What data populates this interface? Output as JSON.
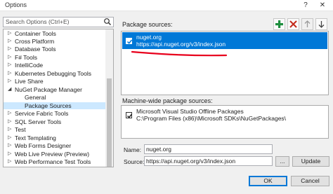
{
  "window": {
    "title": "Options",
    "help_glyph": "?",
    "close_glyph": "✕"
  },
  "search": {
    "text": "Search Options (Ctrl+E)"
  },
  "tree": {
    "items": [
      {
        "label": "Container Tools",
        "arrow": "▷"
      },
      {
        "label": "Cross Platform",
        "arrow": "▷"
      },
      {
        "label": "Database Tools",
        "arrow": "▷"
      },
      {
        "label": "F# Tools",
        "arrow": "▷"
      },
      {
        "label": "IntelliCode",
        "arrow": "▷"
      },
      {
        "label": "Kubernetes Debugging Tools",
        "arrow": "▷"
      },
      {
        "label": "Live Share",
        "arrow": "▷"
      },
      {
        "label": "NuGet Package Manager",
        "arrow": "◢"
      },
      {
        "label": "General",
        "arrow": ""
      },
      {
        "label": "Package Sources",
        "arrow": ""
      },
      {
        "label": "Service Fabric Tools",
        "arrow": "▷"
      },
      {
        "label": "SQL Server Tools",
        "arrow": "▷"
      },
      {
        "label": "Test",
        "arrow": "▷"
      },
      {
        "label": "Text Templating",
        "arrow": "▷"
      },
      {
        "label": "Web Forms Designer",
        "arrow": "▷"
      },
      {
        "label": "Web Live Preview (Preview)",
        "arrow": "▷"
      },
      {
        "label": "Web Performance Test Tools",
        "arrow": "▷"
      }
    ]
  },
  "package_sources": {
    "label": "Package sources:",
    "items": [
      {
        "name": "nuget.org",
        "source": "https://api.nuget.org/v3/index.json",
        "checked": true
      }
    ]
  },
  "machine_sources": {
    "label": "Machine-wide package sources:",
    "items": [
      {
        "name": "Microsoft Visual Studio Offline Packages",
        "source": "C:\\Program Files (x86)\\Microsoft SDKs\\NuGetPackages\\",
        "checked": true
      }
    ]
  },
  "form": {
    "name_label": "Name:",
    "name_value": "nuget.org",
    "source_label": "Source:",
    "source_value": "https://api.nuget.org/v3/index.json",
    "browse_label": "...",
    "update_label": "Update"
  },
  "buttons": {
    "ok": "OK",
    "cancel": "Cancel"
  },
  "colors": {
    "selection": "#0078d7",
    "tree_selection": "#cce8ff",
    "annotation": "#e8001c",
    "add_icon": "#1e8e3e",
    "remove_icon": "#c42b1c"
  }
}
